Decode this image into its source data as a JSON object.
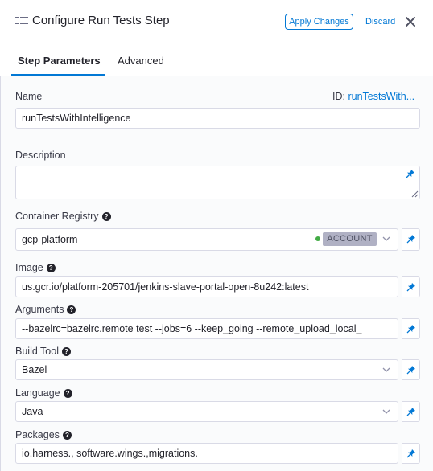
{
  "header": {
    "title": "Configure Run Tests Step",
    "apply_label": "Apply Changes",
    "discard_label": "Discard"
  },
  "tabs": {
    "step_parameters": "Step Parameters",
    "advanced": "Advanced"
  },
  "form": {
    "name_label": "Name",
    "id_prefix": "ID:",
    "id_value": "runTestsWith...",
    "name_value": "runTestsWithIntelligence",
    "description_label": "Description",
    "description_value": "",
    "container_registry_label": "Container Registry",
    "container_registry_value": "gcp-platform",
    "container_registry_scope": "ACCOUNT",
    "image_label": "Image",
    "image_value": "us.gcr.io/platform-205701/jenkins-slave-portal-open-8u242:latest",
    "arguments_label": "Arguments",
    "arguments_value": "--bazelrc=bazelrc.remote test --jobs=6 --keep_going --remote_upload_local_",
    "build_tool_label": "Build Tool",
    "build_tool_value": "Bazel",
    "language_label": "Language",
    "language_value": "Java",
    "packages_label": "Packages",
    "packages_value": "io.harness., software.wings.,migrations."
  },
  "colors": {
    "accent": "#0278d5",
    "status_connected": "#42ab45",
    "badge_bg": "#b0b1c4"
  },
  "icons": [
    "run-tests-step-icon",
    "close-icon",
    "help-icon",
    "pin-icon",
    "chevron-down-icon"
  ]
}
